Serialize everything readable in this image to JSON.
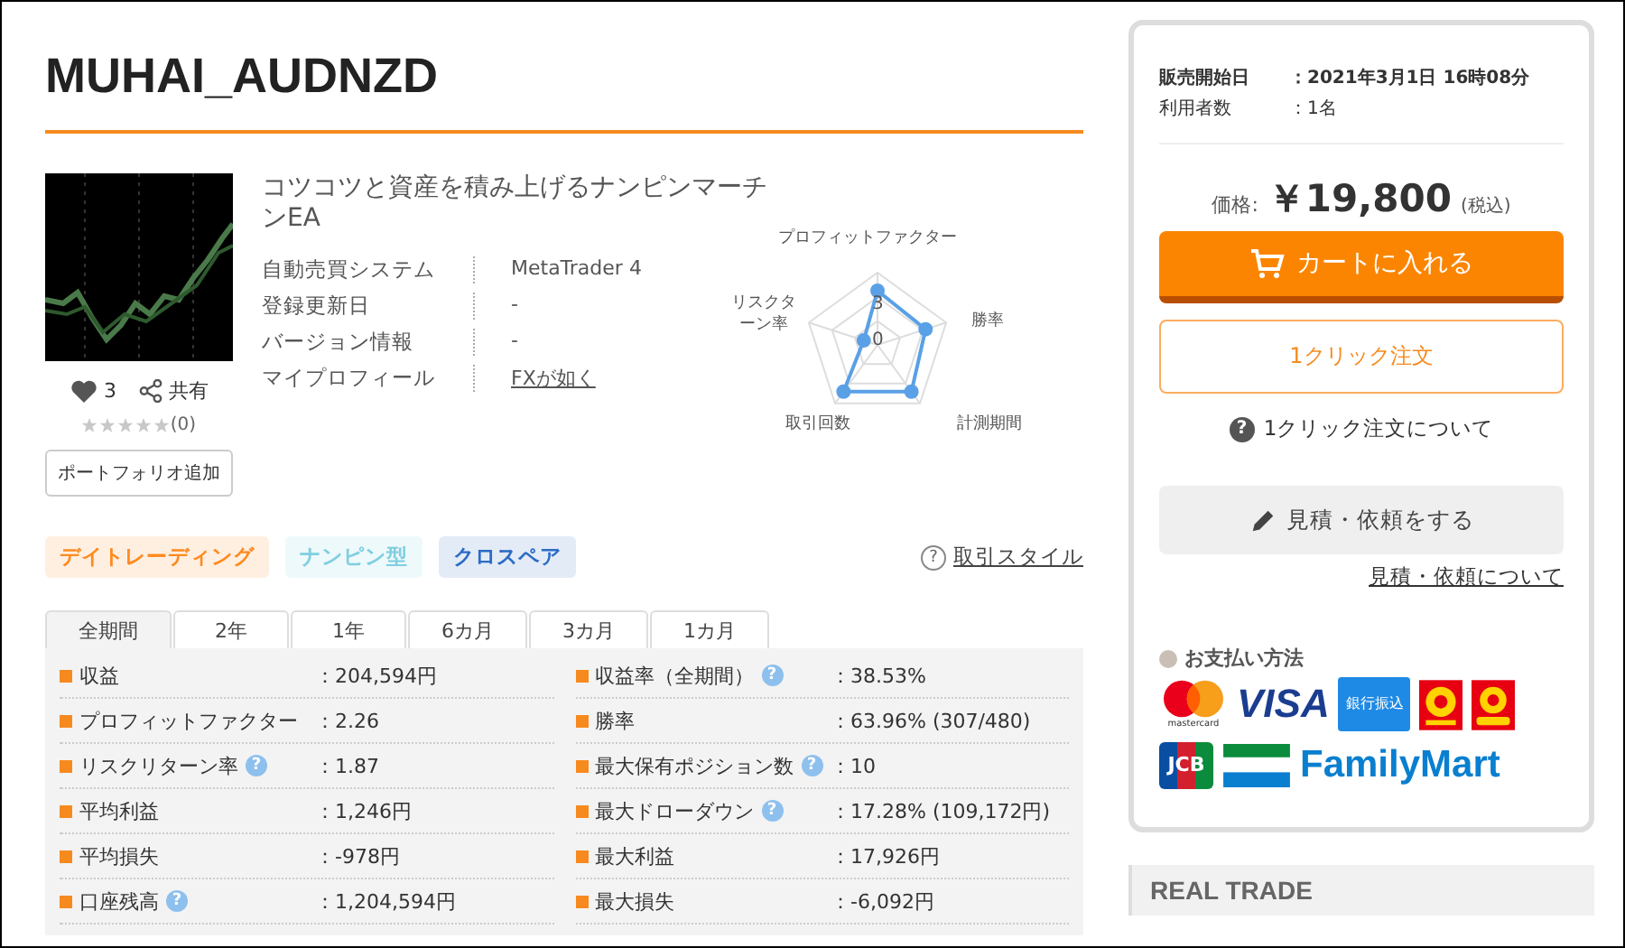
{
  "title": "MUHAI_AUDNZD",
  "product": {
    "headline": "コツコツと資産を積み上げるナンピンマーチンEA",
    "likes": "3",
    "share": "共有",
    "stars": 0,
    "review_count": "(0)",
    "portfolio_button": "ポートフォリオ追加"
  },
  "info": [
    {
      "label": "自動売買システム",
      "value": "MetaTrader 4",
      "link": false
    },
    {
      "label": "登録更新日",
      "value": "-",
      "link": false
    },
    {
      "label": "バージョン情報",
      "value": "-",
      "link": false
    },
    {
      "label": "マイプロフィール",
      "value": "FXが如く",
      "link": true
    }
  ],
  "radar": {
    "axes": [
      "プロフィットファクター",
      "勝率",
      "計測期間",
      "取引回数",
      "リスクターン率"
    ],
    "tick_high": "3",
    "tick_low": "0"
  },
  "tags": [
    {
      "label": "デイトレーディング",
      "color": "#ff8a1f"
    },
    {
      "label": "ナンピン型",
      "color": "#7fcfe0"
    },
    {
      "label": "クロスペア",
      "color": "#2b6cc4"
    }
  ],
  "style_help": "?",
  "style_link": "取引スタイル",
  "tabs": [
    {
      "label": "全期間",
      "selected": true
    },
    {
      "label": "2年",
      "selected": false
    },
    {
      "label": "1年",
      "selected": false
    },
    {
      "label": "6カ月",
      "selected": false
    },
    {
      "label": "3カ月",
      "selected": false
    },
    {
      "label": "1カ月",
      "selected": false
    }
  ],
  "stats": [
    [
      {
        "label": "収益",
        "value": "：204,594円"
      },
      {
        "label": "プロフィットファクター",
        "value": "：2.26"
      },
      {
        "label": "リスクリターン率",
        "help": "?",
        "value": "：1.87"
      },
      {
        "label": "平均利益",
        "value": "：1,246円"
      },
      {
        "label": "平均損失",
        "value": "：-978円"
      },
      {
        "label": "口座残高",
        "help": "?",
        "value": "：1,204,594円"
      }
    ],
    [
      {
        "label": "収益率（全期間）",
        "help": "?",
        "value": "：38.53%"
      },
      {
        "label": "勝率",
        "value": "：63.96% (307/480)"
      },
      {
        "label": "最大保有ポジション数",
        "help": "?",
        "value": "：10"
      },
      {
        "label": "最大ドローダウン",
        "help": "?",
        "value": "：17.28% (109,172円)"
      },
      {
        "label": "最大利益",
        "value": "：17,926円"
      },
      {
        "label": "最大損失",
        "value": "：-6,092円"
      }
    ]
  ],
  "sale": {
    "start_label": "販売開始日",
    "start_value": "：2021年3月1日 16時08分",
    "users_label": "利用者数",
    "users_value": "：1名"
  },
  "price": {
    "label": "価格:",
    "amount": "￥19,800",
    "tax": "(税込)"
  },
  "cart_button": "カートに入れる",
  "one_click_button": "1クリック注文",
  "one_click_help_icon": "?",
  "one_click_help": "1クリック注文について",
  "quote_button": "見積・依頼をする",
  "quote_link": "見積・依頼について",
  "payment": {
    "title": "お支払い方法",
    "methods": [
      {
        "kind": "mastercard",
        "label": "mastercard"
      },
      {
        "kind": "visa",
        "label": "VISA"
      },
      {
        "kind": "bank",
        "label": "銀行振込"
      },
      {
        "kind": "dpoint"
      },
      {
        "kind": "daily"
      },
      {
        "kind": "jcb",
        "label": "JCB"
      },
      {
        "kind": "famima"
      },
      {
        "kind": "famima_text",
        "label": "FamilyMart"
      }
    ]
  },
  "real_trade": "REAL TRADE"
}
